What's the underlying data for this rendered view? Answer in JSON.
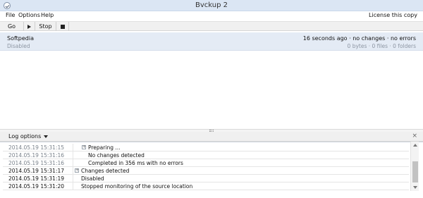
{
  "window": {
    "title": "Bvckup 2"
  },
  "menubar": {
    "items": [
      {
        "label": "File"
      },
      {
        "label": "Options"
      },
      {
        "label": "Help"
      }
    ],
    "license_link": "License this copy"
  },
  "toolbar": {
    "go_label": "Go",
    "play_icon": "play-icon",
    "stop_label": "Stop",
    "stop_icon": "stop-icon"
  },
  "jobs": [
    {
      "name": "Softpedia",
      "state": "Disabled",
      "status": "16 seconds ago  ·  no changes  ·  no errors",
      "counts": "0 bytes  ·  0 files  ·  0 folders"
    }
  ],
  "log": {
    "options_label": "Log options",
    "close_label": "×",
    "entries": [
      {
        "timestamp": "2014.05.19 15:31:15",
        "message": "Preparing ...",
        "level": 1,
        "expandable": true,
        "muted": true
      },
      {
        "timestamp": "2014.05.19 15:31:16",
        "message": "No changes detected",
        "level": 2,
        "expandable": false,
        "muted": true
      },
      {
        "timestamp": "2014.05.19 15:31:16",
        "message": "Completed in 356 ms with no errors",
        "level": 2,
        "expandable": false,
        "muted": true
      },
      {
        "timestamp": "2014.05.19 15:31:17",
        "message": "Changes detected",
        "level": 0,
        "expandable": true,
        "muted": false
      },
      {
        "timestamp": "2014.05.19 15:31:19",
        "message": "Disabled",
        "level": 0,
        "expandable": false,
        "muted": false
      },
      {
        "timestamp": "2014.05.19 15:31:20",
        "message": "Stopped monitoring of the source location",
        "level": 0,
        "expandable": false,
        "muted": false
      }
    ]
  }
}
